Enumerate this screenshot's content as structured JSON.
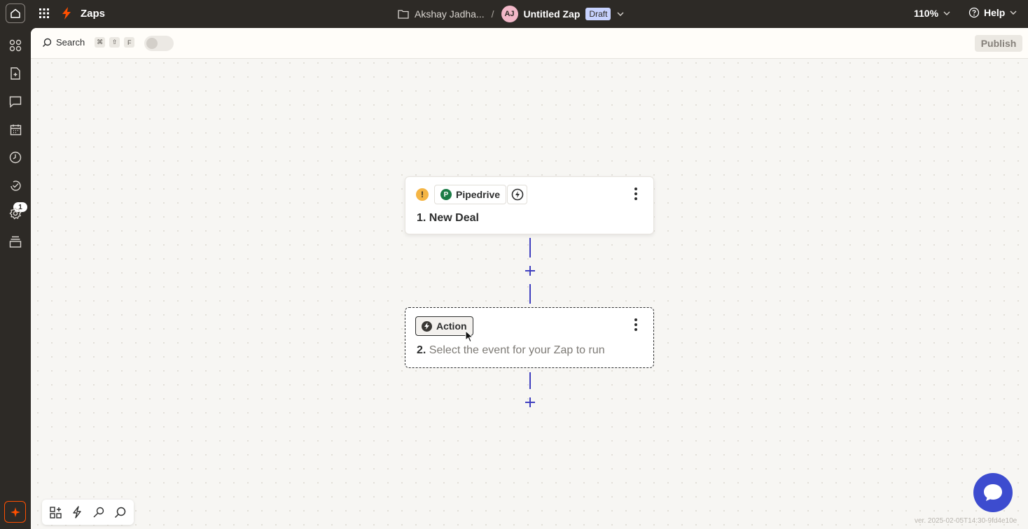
{
  "topbar": {
    "app_title": "Zaps",
    "breadcrumb_owner": "Akshay Jadha...",
    "breadcrumb_separator": "/",
    "avatar_initials": "AJ",
    "zap_name": "Untitled Zap",
    "status_badge": "Draft",
    "zoom": "110%",
    "help_label": "Help"
  },
  "sidebar": {
    "items": [
      {
        "name": "apps-icon"
      },
      {
        "name": "document-icon"
      },
      {
        "name": "chat-icon"
      },
      {
        "name": "calendar-icon"
      },
      {
        "name": "history-icon"
      },
      {
        "name": "activity-icon"
      },
      {
        "name": "settings-icon"
      },
      {
        "name": "layers-icon"
      }
    ],
    "badge_count": "1"
  },
  "toolbar": {
    "search_label": "Search",
    "shortcut_keys": [
      "⌘",
      "⇧",
      "F"
    ],
    "publish_label": "Publish"
  },
  "steps": [
    {
      "number": "1.",
      "app_name": "Pipedrive",
      "app_logo_letter": "P",
      "title": "New Deal",
      "warning": "!"
    },
    {
      "number": "2.",
      "chip_label": "Action",
      "placeholder": "Select the event for your Zap to run"
    }
  ],
  "footer": {
    "version": "ver. 2025-02-05T14:30-9fd4e10e"
  },
  "colors": {
    "accent_orange": "#ff4f00",
    "connector_blue": "#3f3fbf",
    "chat_blue": "#3d4ccf",
    "draft_badge": "#c7d2fe"
  }
}
